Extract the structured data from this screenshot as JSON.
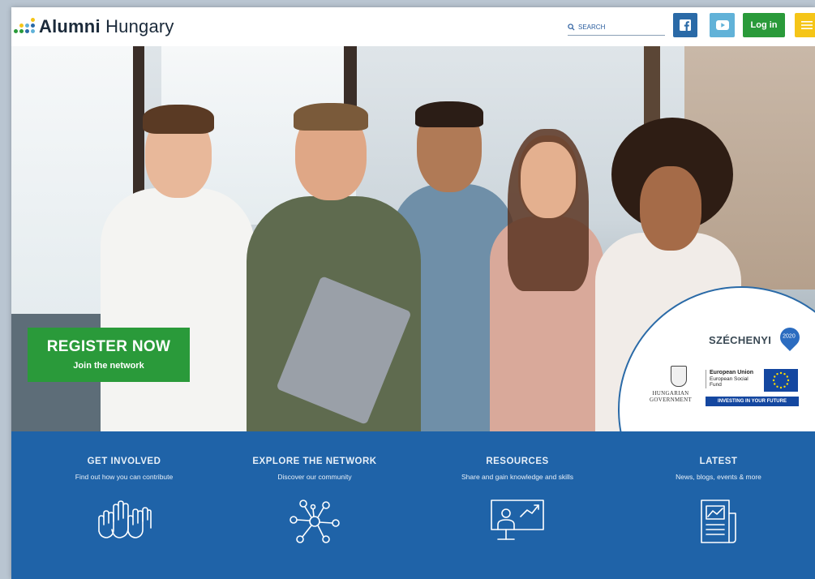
{
  "header": {
    "logo": {
      "bold": "Alumni",
      "regular": " Hungary"
    },
    "search": {
      "placeholder": "SEARCH"
    },
    "login_label": "Log in"
  },
  "hero": {
    "register": {
      "title": "REGISTER NOW",
      "subtitle": "Join the network"
    },
    "badge": {
      "szechenyi": "SZÉCHENYI",
      "szechenyi_year": "2020",
      "gov_line1": "HUNGARIAN",
      "gov_line2": "GOVERNMENT",
      "eu_title": "European Union",
      "eu_line2": "European Social",
      "eu_line3": "Fund",
      "eu_bar": "INVESTING IN YOUR FUTURE"
    }
  },
  "sections": [
    {
      "title": "GET INVOLVED",
      "subtitle": "Find out how you can contribute",
      "icon": "raised-hands-icon"
    },
    {
      "title": "EXPLORE THE NETWORK",
      "subtitle": "Discover our community",
      "icon": "network-icon"
    },
    {
      "title": "RESOURCES",
      "subtitle": "Share and gain knowledge and skills",
      "icon": "presentation-icon"
    },
    {
      "title": "LATEST",
      "subtitle": "News, blogs, events & more",
      "icon": "newspaper-icon"
    }
  ],
  "colors": {
    "accent_green": "#2a9a3a",
    "brand_blue": "#1f63a8",
    "facebook": "#2a6aa7",
    "youtube": "#61b2d8",
    "menu_yellow": "#f5c518"
  }
}
